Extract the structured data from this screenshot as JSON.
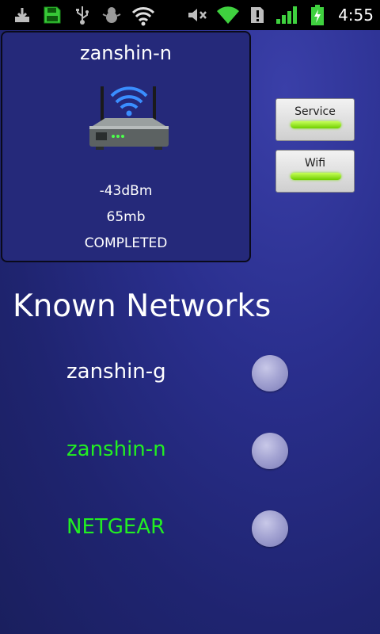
{
  "status_bar": {
    "time": "4:55",
    "icons": [
      "download-icon",
      "sd-card-icon",
      "usb-icon",
      "android-debug-icon",
      "wifi-broadcast-icon",
      "mute-icon",
      "wifi-signal-icon",
      "alert-icon",
      "cell-signal-icon",
      "battery-charging-icon"
    ]
  },
  "current_network": {
    "ssid": "zanshin-n",
    "signal": "-43dBm",
    "speed": "65mb",
    "state": "COMPLETED"
  },
  "toggles": [
    {
      "label": "Service",
      "indicator_color": "#7fdc10"
    },
    {
      "label": "Wifi",
      "indicator_color": "#7fdc10"
    }
  ],
  "known_networks": {
    "title": "Known Networks",
    "items": [
      {
        "name": "zanshin-g",
        "color": "#ffffff"
      },
      {
        "name": "zanshin-n",
        "color": "#22ee22"
      },
      {
        "name": "NETGEAR",
        "color": "#22ee22"
      }
    ]
  }
}
